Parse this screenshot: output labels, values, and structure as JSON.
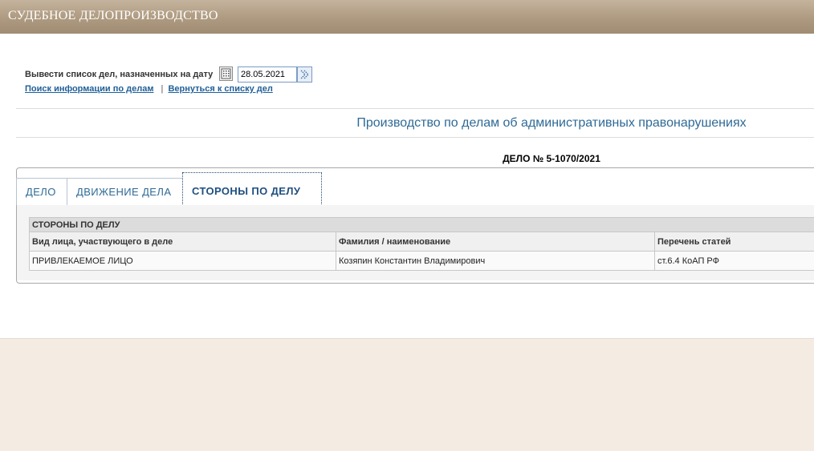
{
  "header": {
    "title": "СУДЕБНОЕ ДЕЛОПРОИЗВОДСТВО"
  },
  "date_filter": {
    "label": "Вывести список дел, назначенных на дату",
    "date_value": "28.05.2021"
  },
  "links": {
    "search": "Поиск информации по делам",
    "separator": "|",
    "back": "Вернуться к списку дел"
  },
  "section_title": "Производство по делам об административных правонарушениях",
  "case_number": "ДЕЛО № 5-1070/2021",
  "tabs": [
    {
      "label": "ДЕЛО",
      "active": false
    },
    {
      "label": "ДВИЖЕНИЕ ДЕЛА",
      "active": false
    },
    {
      "label": "СТОРОНЫ ПО ДЕЛУ",
      "active": true
    }
  ],
  "parties_table": {
    "caption": "СТОРОНЫ ПО ДЕЛУ",
    "columns": [
      "Вид лица, участвующего в деле",
      "Фамилия / наименование",
      "Перечень статей"
    ],
    "rows": [
      [
        "ПРИВЛЕКАЕМОЕ ЛИЦО",
        "Козяпин Константин Владимирович",
        "ст.6.4 КоАП РФ"
      ]
    ]
  },
  "icons": {
    "calendar": "calendar-icon",
    "go": "double-chevron-right-icon"
  }
}
